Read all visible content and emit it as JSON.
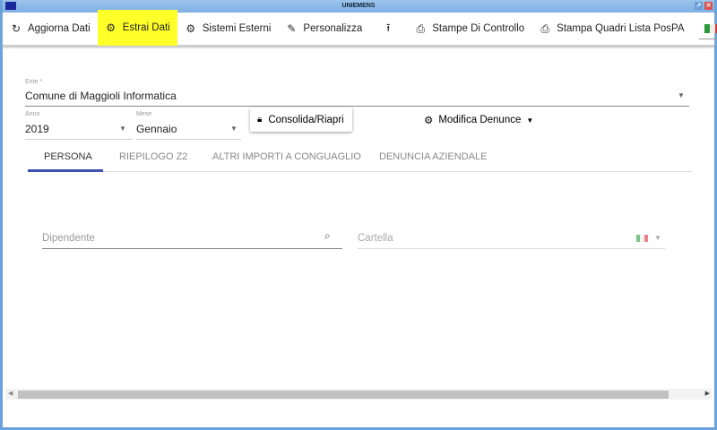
{
  "window": {
    "title": "UNIEMENS"
  },
  "toolbar": {
    "items": [
      {
        "label": "Aggiorna Dati",
        "icon": "refresh-icon"
      },
      {
        "label": "Estrai Dati",
        "icon": "gear-icon"
      },
      {
        "label": "Sistemi Esterni",
        "icon": "gears-icon"
      },
      {
        "label": "Personalizza",
        "icon": "pencil-icon"
      },
      {
        "label": "",
        "icon": "upload-icon"
      },
      {
        "label": "Stampe Di Controllo",
        "icon": "printer-icon"
      },
      {
        "label": "Stampa Quadri Lista PosPA",
        "icon": "printer-icon"
      }
    ],
    "highlight_color": "#ffff2a"
  },
  "form": {
    "ente": {
      "label": "Ente *",
      "value": "Comune di Maggioli Informatica"
    },
    "anno": {
      "label": "Anno",
      "value": "2019"
    },
    "mese": {
      "label": "Mese",
      "value": "Gennaio"
    },
    "consolida_label": "Consolida/Riapri",
    "modifica_label": "Modifica Denunce"
  },
  "tabs": [
    "PERSONA",
    "RIEPILOGO Z2",
    "ALTRI IMPORTI A CONGUAGLIO",
    "DENUNCIA AZIENDALE"
  ],
  "active_tab_color": "#3f51b5",
  "persona": {
    "dipendente_placeholder": "Dipendente",
    "cartella_placeholder": "Cartella"
  }
}
